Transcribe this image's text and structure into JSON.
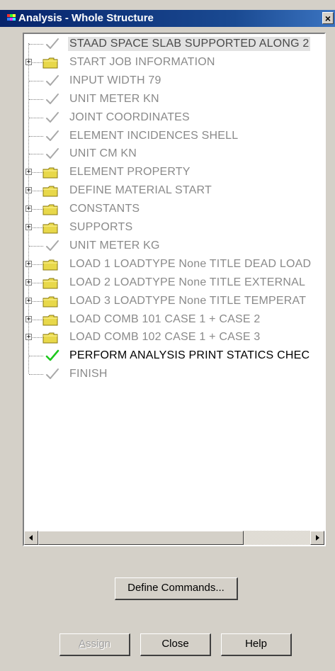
{
  "window": {
    "title": "Analysis - Whole Structure",
    "close_label": "×"
  },
  "tree": {
    "nodes": [
      {
        "label": "STAAD SPACE SLAB SUPPORTED ALONG 2",
        "icon": "check-grey",
        "expandable": false,
        "state": "selected"
      },
      {
        "label": "START JOB INFORMATION",
        "icon": "folder",
        "expandable": true,
        "state": "normal"
      },
      {
        "label": "INPUT WIDTH 79",
        "icon": "check-grey",
        "expandable": false,
        "state": "normal"
      },
      {
        "label": "UNIT METER KN",
        "icon": "check-grey",
        "expandable": false,
        "state": "normal"
      },
      {
        "label": "JOINT COORDINATES",
        "icon": "check-grey",
        "expandable": false,
        "state": "normal"
      },
      {
        "label": "ELEMENT INCIDENCES SHELL",
        "icon": "check-grey",
        "expandable": false,
        "state": "normal"
      },
      {
        "label": "UNIT CM KN",
        "icon": "check-grey",
        "expandable": false,
        "state": "normal"
      },
      {
        "label": "ELEMENT PROPERTY",
        "icon": "folder",
        "expandable": true,
        "state": "normal"
      },
      {
        "label": "DEFINE MATERIAL START",
        "icon": "folder",
        "expandable": true,
        "state": "normal"
      },
      {
        "label": "CONSTANTS",
        "icon": "folder",
        "expandable": true,
        "state": "normal"
      },
      {
        "label": "SUPPORTS",
        "icon": "folder",
        "expandable": true,
        "state": "normal"
      },
      {
        "label": "UNIT METER KG",
        "icon": "check-grey",
        "expandable": false,
        "state": "normal"
      },
      {
        "label": "LOAD 1 LOADTYPE None  TITLE DEAD LOAD",
        "icon": "folder",
        "expandable": true,
        "state": "normal"
      },
      {
        "label": "LOAD 2 LOADTYPE None  TITLE EXTERNAL",
        "icon": "folder",
        "expandable": true,
        "state": "normal"
      },
      {
        "label": "LOAD 3 LOADTYPE None  TITLE TEMPERAT",
        "icon": "folder",
        "expandable": true,
        "state": "normal"
      },
      {
        "label": "LOAD COMB 101 CASE 1  + CASE 2",
        "icon": "folder",
        "expandable": true,
        "state": "normal"
      },
      {
        "label": "LOAD COMB 102 CASE 1 + CASE 3",
        "icon": "folder",
        "expandable": true,
        "state": "normal"
      },
      {
        "label": "PERFORM ANALYSIS PRINT STATICS CHEC",
        "icon": "check-green",
        "expandable": false,
        "state": "active"
      },
      {
        "label": "FINISH",
        "icon": "check-grey",
        "expandable": false,
        "state": "normal"
      }
    ]
  },
  "buttons": {
    "define_commands": "Define Commands...",
    "assign": "Assign",
    "close": "Close",
    "help": "Help"
  },
  "colors": {
    "folder": "#e8d84a",
    "check_grey": "#a8a8a8",
    "check_green": "#1ec81e",
    "text_inactive": "#8a8a8a",
    "text_active": "#000000"
  }
}
